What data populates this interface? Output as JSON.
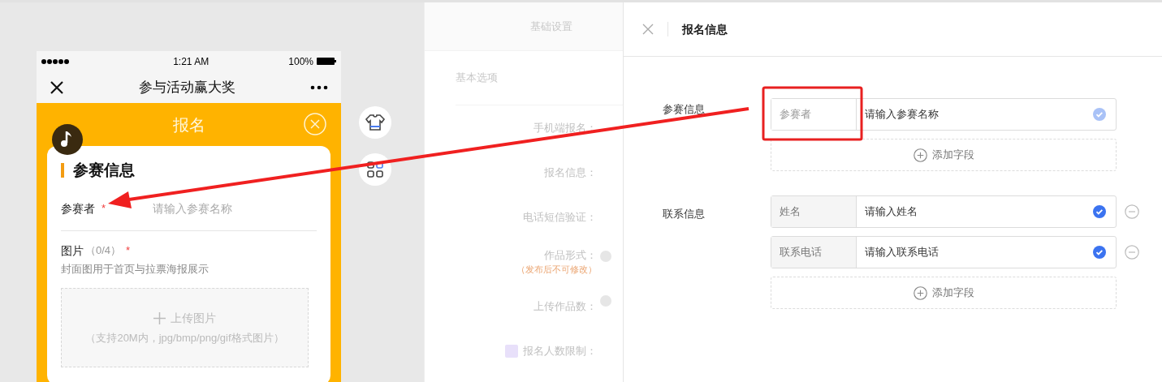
{
  "phone": {
    "status_bar": {
      "time": "1:21 AM",
      "battery": "100%"
    },
    "nav": {
      "title": "参与活动赢大奖"
    },
    "header": {
      "title": "报名"
    },
    "card": {
      "section_title": "参赛信息",
      "fields": [
        {
          "label": "参赛者",
          "required_mark": "*",
          "placeholder": "请输入参赛名称"
        }
      ],
      "upload": {
        "label": "图片",
        "count": "（0/4）",
        "required_mark": "*",
        "hint": "封面图用于首页与拉票海报展示",
        "button": "上传图片",
        "note": "（支持20M内，jpg/bmp/png/gif格式图片）"
      }
    }
  },
  "settings": {
    "tab": "基础设置",
    "section": "基本选项",
    "rows": [
      {
        "label": "手机端报名：",
        "help": false,
        "flagged": false
      },
      {
        "label": "报名信息：",
        "help": false,
        "flagged": false
      },
      {
        "label": "电话短信验证：",
        "help": false,
        "flagged": false
      },
      {
        "label": "作品形式：",
        "help": true,
        "flagged": false,
        "note": "（发布后不可修改）"
      },
      {
        "label": "上传作品数：",
        "help": true,
        "flagged": false
      },
      {
        "label": "报名人数限制：",
        "help": false,
        "flagged": true
      }
    ]
  },
  "drawer": {
    "title": "报名信息",
    "groups": [
      {
        "label": "参赛信息",
        "fields": [
          {
            "name": "参赛者",
            "placeholder": "请输入参赛名称",
            "name_editable": true,
            "locked": true,
            "removable": false
          }
        ],
        "add_button": "添加字段"
      },
      {
        "label": "联系信息",
        "fields": [
          {
            "name": "姓名",
            "placeholder": "请输入姓名",
            "name_editable": false,
            "locked": false,
            "removable": true
          },
          {
            "name": "联系电话",
            "placeholder": "请输入联系电话",
            "name_editable": false,
            "locked": false,
            "removable": true
          }
        ],
        "add_button": "添加字段"
      }
    ]
  }
}
